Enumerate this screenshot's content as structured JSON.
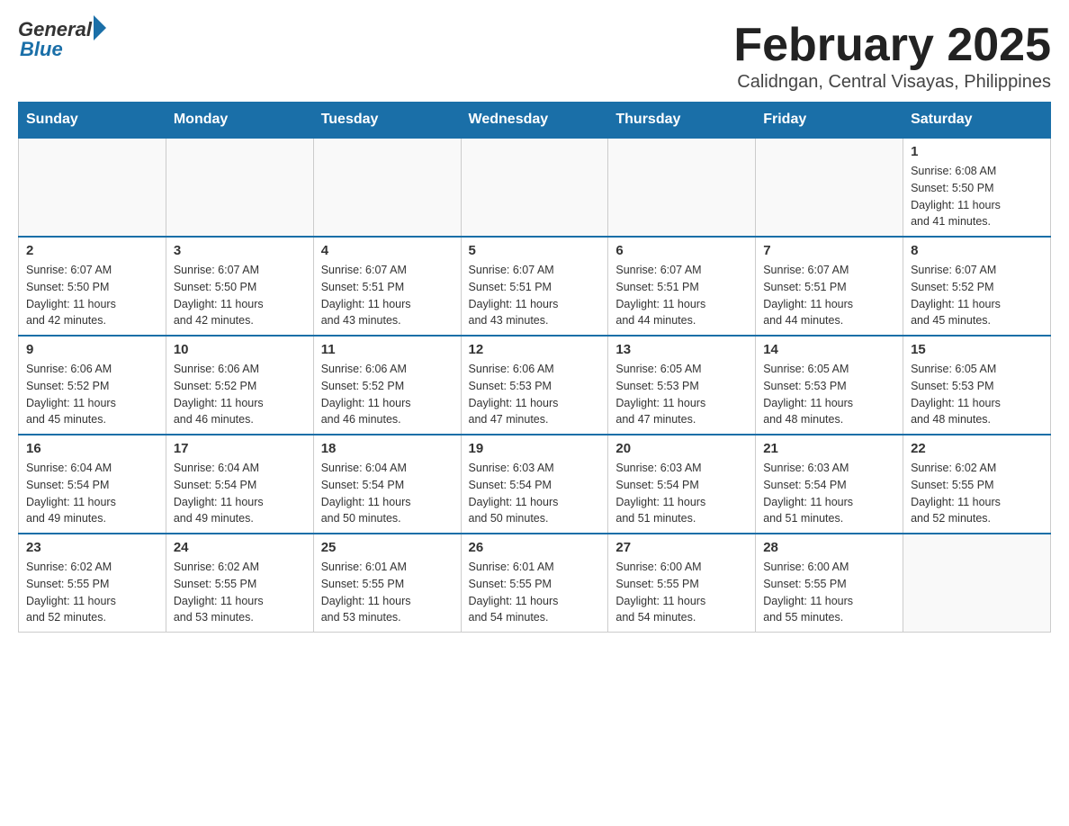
{
  "header": {
    "logo": {
      "general": "General",
      "blue": "Blue"
    },
    "title": "February 2025",
    "location": "Calidngan, Central Visayas, Philippines"
  },
  "days_of_week": [
    "Sunday",
    "Monday",
    "Tuesday",
    "Wednesday",
    "Thursday",
    "Friday",
    "Saturday"
  ],
  "weeks": [
    {
      "days": [
        {
          "number": "",
          "info": "",
          "empty": true
        },
        {
          "number": "",
          "info": "",
          "empty": true
        },
        {
          "number": "",
          "info": "",
          "empty": true
        },
        {
          "number": "",
          "info": "",
          "empty": true
        },
        {
          "number": "",
          "info": "",
          "empty": true
        },
        {
          "number": "",
          "info": "",
          "empty": true
        },
        {
          "number": "1",
          "info": "Sunrise: 6:08 AM\nSunset: 5:50 PM\nDaylight: 11 hours\nand 41 minutes.",
          "empty": false
        }
      ]
    },
    {
      "days": [
        {
          "number": "2",
          "info": "Sunrise: 6:07 AM\nSunset: 5:50 PM\nDaylight: 11 hours\nand 42 minutes.",
          "empty": false
        },
        {
          "number": "3",
          "info": "Sunrise: 6:07 AM\nSunset: 5:50 PM\nDaylight: 11 hours\nand 42 minutes.",
          "empty": false
        },
        {
          "number": "4",
          "info": "Sunrise: 6:07 AM\nSunset: 5:51 PM\nDaylight: 11 hours\nand 43 minutes.",
          "empty": false
        },
        {
          "number": "5",
          "info": "Sunrise: 6:07 AM\nSunset: 5:51 PM\nDaylight: 11 hours\nand 43 minutes.",
          "empty": false
        },
        {
          "number": "6",
          "info": "Sunrise: 6:07 AM\nSunset: 5:51 PM\nDaylight: 11 hours\nand 44 minutes.",
          "empty": false
        },
        {
          "number": "7",
          "info": "Sunrise: 6:07 AM\nSunset: 5:51 PM\nDaylight: 11 hours\nand 44 minutes.",
          "empty": false
        },
        {
          "number": "8",
          "info": "Sunrise: 6:07 AM\nSunset: 5:52 PM\nDaylight: 11 hours\nand 45 minutes.",
          "empty": false
        }
      ]
    },
    {
      "days": [
        {
          "number": "9",
          "info": "Sunrise: 6:06 AM\nSunset: 5:52 PM\nDaylight: 11 hours\nand 45 minutes.",
          "empty": false
        },
        {
          "number": "10",
          "info": "Sunrise: 6:06 AM\nSunset: 5:52 PM\nDaylight: 11 hours\nand 46 minutes.",
          "empty": false
        },
        {
          "number": "11",
          "info": "Sunrise: 6:06 AM\nSunset: 5:52 PM\nDaylight: 11 hours\nand 46 minutes.",
          "empty": false
        },
        {
          "number": "12",
          "info": "Sunrise: 6:06 AM\nSunset: 5:53 PM\nDaylight: 11 hours\nand 47 minutes.",
          "empty": false
        },
        {
          "number": "13",
          "info": "Sunrise: 6:05 AM\nSunset: 5:53 PM\nDaylight: 11 hours\nand 47 minutes.",
          "empty": false
        },
        {
          "number": "14",
          "info": "Sunrise: 6:05 AM\nSunset: 5:53 PM\nDaylight: 11 hours\nand 48 minutes.",
          "empty": false
        },
        {
          "number": "15",
          "info": "Sunrise: 6:05 AM\nSunset: 5:53 PM\nDaylight: 11 hours\nand 48 minutes.",
          "empty": false
        }
      ]
    },
    {
      "days": [
        {
          "number": "16",
          "info": "Sunrise: 6:04 AM\nSunset: 5:54 PM\nDaylight: 11 hours\nand 49 minutes.",
          "empty": false
        },
        {
          "number": "17",
          "info": "Sunrise: 6:04 AM\nSunset: 5:54 PM\nDaylight: 11 hours\nand 49 minutes.",
          "empty": false
        },
        {
          "number": "18",
          "info": "Sunrise: 6:04 AM\nSunset: 5:54 PM\nDaylight: 11 hours\nand 50 minutes.",
          "empty": false
        },
        {
          "number": "19",
          "info": "Sunrise: 6:03 AM\nSunset: 5:54 PM\nDaylight: 11 hours\nand 50 minutes.",
          "empty": false
        },
        {
          "number": "20",
          "info": "Sunrise: 6:03 AM\nSunset: 5:54 PM\nDaylight: 11 hours\nand 51 minutes.",
          "empty": false
        },
        {
          "number": "21",
          "info": "Sunrise: 6:03 AM\nSunset: 5:54 PM\nDaylight: 11 hours\nand 51 minutes.",
          "empty": false
        },
        {
          "number": "22",
          "info": "Sunrise: 6:02 AM\nSunset: 5:55 PM\nDaylight: 11 hours\nand 52 minutes.",
          "empty": false
        }
      ]
    },
    {
      "days": [
        {
          "number": "23",
          "info": "Sunrise: 6:02 AM\nSunset: 5:55 PM\nDaylight: 11 hours\nand 52 minutes.",
          "empty": false
        },
        {
          "number": "24",
          "info": "Sunrise: 6:02 AM\nSunset: 5:55 PM\nDaylight: 11 hours\nand 53 minutes.",
          "empty": false
        },
        {
          "number": "25",
          "info": "Sunrise: 6:01 AM\nSunset: 5:55 PM\nDaylight: 11 hours\nand 53 minutes.",
          "empty": false
        },
        {
          "number": "26",
          "info": "Sunrise: 6:01 AM\nSunset: 5:55 PM\nDaylight: 11 hours\nand 54 minutes.",
          "empty": false
        },
        {
          "number": "27",
          "info": "Sunrise: 6:00 AM\nSunset: 5:55 PM\nDaylight: 11 hours\nand 54 minutes.",
          "empty": false
        },
        {
          "number": "28",
          "info": "Sunrise: 6:00 AM\nSunset: 5:55 PM\nDaylight: 11 hours\nand 55 minutes.",
          "empty": false
        },
        {
          "number": "",
          "info": "",
          "empty": true
        }
      ]
    }
  ]
}
